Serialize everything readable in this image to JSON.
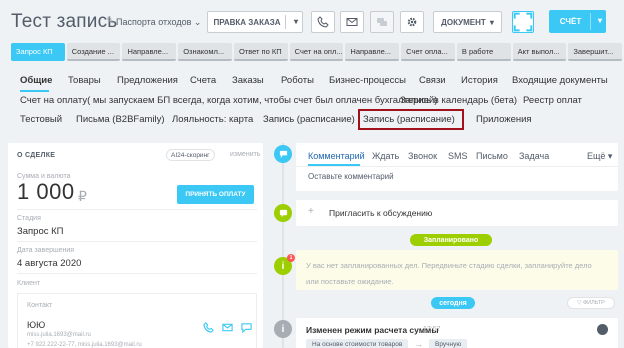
{
  "header": {
    "title": "Тест запись",
    "category": "Паспорта отходов",
    "category_caret": "⌄",
    "edit_icon": "✎",
    "order_button": "ПРАВКА ЗАКАЗА",
    "document_button": "ДОКУМЕНТ",
    "check_button": "СЧЁТ",
    "caret": "▾"
  },
  "stages": [
    {
      "label": "Запрос КП",
      "active": true
    },
    {
      "label": "Создание ...",
      "active": false
    },
    {
      "label": "Направле...",
      "active": false
    },
    {
      "label": "Ознакомл...",
      "active": false
    },
    {
      "label": "Ответ по КП",
      "active": false
    },
    {
      "label": "Счет на опл...",
      "active": false
    },
    {
      "label": "Направле...",
      "active": false
    },
    {
      "label": "Счет опла...",
      "active": false
    },
    {
      "label": "В работе",
      "active": false
    },
    {
      "label": "Акт выпол...",
      "active": false
    },
    {
      "label": "Завершит...",
      "active": false
    }
  ],
  "tabs": {
    "row1": [
      "Общие",
      "Товары",
      "Предложения",
      "Счета",
      "Заказы",
      "Роботы",
      "Бизнес-процессы",
      "Связи",
      "История",
      "Входящие документы"
    ],
    "row2": [
      "Счет на оплату( мы запускаем БП всегда, когда хотим, чтобы счет был оплачен бухгалтерией)",
      "Запись в календарь (бета)",
      "Реестр оплат"
    ],
    "row3": [
      "Тестовый",
      "Письма (B2BFamily)",
      "Лояльность: карта",
      "Запись (расписание)",
      "Запись (расписание)",
      "Приложения"
    ]
  },
  "deal": {
    "section_title": "О СДЕЛКЕ",
    "scoring": "AI24-скоринг",
    "change": "изменить",
    "amount_label": "Сумма и валюта",
    "amount": "1 000",
    "currency": "₽",
    "accept_payment": "ПРИНЯТЬ ОПЛАТУ",
    "stage_label": "Стадия",
    "stage_value": "Запрос КП",
    "date_label": "Дата завершения",
    "date_value": "4 августа 2020",
    "client_label": "Клиент",
    "contact_label": "Контакт",
    "contact_name": "ЮЮ",
    "contact_email": "miss.julia.1693@mail.ru",
    "contact_phone": "+7 922 222-22-77, miss.julia.1693@mail.ru"
  },
  "timeline": {
    "composer_tabs": [
      "Комментарий",
      "Ждать",
      "Звонок",
      "SMS",
      "Письмо",
      "Задача",
      "Ещё ▾"
    ],
    "composer_placeholder": "Оставьте комментарий",
    "invite": "Пригласить к обсуждению",
    "invite_plus": "+",
    "planned_pill": "Запланировано",
    "planned_text": "У вас нет запланированных дел. Передвиньте стадию сделки, запланируйте дело или поставьте ожидание.",
    "notice_count": "1",
    "today_pill": "сегодня",
    "filter": "▽ ФИЛЬТР",
    "history_title": "Изменен режим расчета суммы",
    "history_time": "17:57",
    "history_from": "На основе стоимости товаров",
    "history_arrow": "→",
    "history_to": "Вручную"
  },
  "colors": {
    "accent": "#3bc8f5",
    "green": "#9dcf00",
    "highlight": "#a1111c"
  }
}
